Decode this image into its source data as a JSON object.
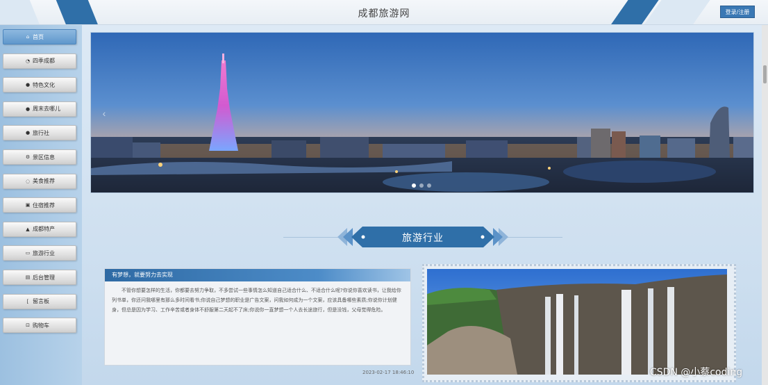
{
  "header": {
    "title": "成都旅游网",
    "login_label": "登录/注册"
  },
  "sidebar": {
    "items": [
      {
        "label": "首页",
        "icon": "home-icon",
        "glyph": "⌂",
        "active": true
      },
      {
        "label": "四季成都",
        "icon": "bag-icon",
        "glyph": "◔",
        "active": false
      },
      {
        "label": "特色文化",
        "icon": "info-icon",
        "glyph": "●",
        "active": false
      },
      {
        "label": "周末去哪儿",
        "icon": "info-icon",
        "glyph": "●",
        "active": false
      },
      {
        "label": "旅行社",
        "icon": "info-icon",
        "glyph": "●",
        "active": false
      },
      {
        "label": "景区信息",
        "icon": "gear-icon",
        "glyph": "⚙",
        "active": false
      },
      {
        "label": "美食推荐",
        "icon": "circle-icon",
        "glyph": "◌",
        "active": false
      },
      {
        "label": "住宿推荐",
        "icon": "building-icon",
        "glyph": "▣",
        "active": false
      },
      {
        "label": "成都特产",
        "icon": "car-icon",
        "glyph": "▲",
        "active": false
      },
      {
        "label": "旅游行业",
        "icon": "document-icon",
        "glyph": "▭",
        "active": false
      },
      {
        "label": "后台管理",
        "icon": "monitor-icon",
        "glyph": "▤",
        "active": false
      },
      {
        "label": "留言板",
        "icon": "bracket-icon",
        "glyph": "[",
        "active": false
      },
      {
        "label": "购物车",
        "icon": "cart-icon",
        "glyph": "⊡",
        "active": false
      }
    ]
  },
  "carousel": {
    "prev_arrow": "‹",
    "dots": 3,
    "active_dot": 0
  },
  "section": {
    "title": "旅游行业"
  },
  "news": {
    "heading": "有梦想，就要努力去实现",
    "body": "不管你想要怎样的生活，你都要去努力争取，不多尝试一些事情怎么知道自己适合什么、不适合什么呢?你说你喜欢读书，让我给你列书单，你还问我哪里有那么多时间看书;你说自己梦想的职业是广告文案，问我如何成为一个文案，应该具备哪些素质;你说你计划健身，但总是因为学习、工作辛苦或者身体不舒服第二天起不了床;你说你一直梦想一个人去长途旅行，但是没钱，父母觉得危险。",
    "date": "2023-02-17 18:46:10"
  },
  "watermark": "CSDN @小蔡coding",
  "colors": {
    "accent": "#3a78b4",
    "sidebar_bg": "#b7d2ea",
    "section_banner": "#2f6fa8"
  }
}
